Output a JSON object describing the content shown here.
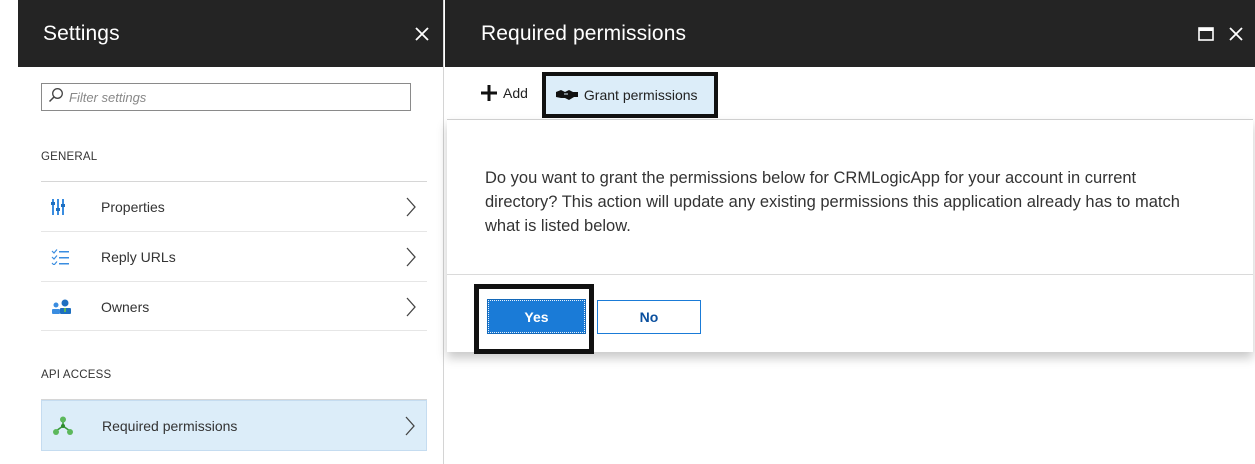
{
  "settings": {
    "title": "Settings",
    "filter_placeholder": "Filter settings",
    "sections": [
      {
        "label": "GENERAL",
        "items": [
          {
            "label": "Properties",
            "icon": "properties-icon"
          },
          {
            "label": "Reply URLs",
            "icon": "reply-urls-icon"
          },
          {
            "label": "Owners",
            "icon": "owners-icon"
          }
        ]
      },
      {
        "label": "API ACCESS",
        "items": [
          {
            "label": "Required permissions",
            "icon": "required-permissions-icon",
            "selected": true
          }
        ]
      }
    ]
  },
  "permissions": {
    "title": "Required permissions",
    "toolbar": {
      "add_label": "Add",
      "grant_label": "Grant permissions"
    },
    "dialog": {
      "message": "Do you want to grant the permissions below for CRMLogicApp for your account in current directory? This action will update any existing permissions this application already has to match what is listed below.",
      "yes_label": "Yes",
      "no_label": "No"
    }
  },
  "colors": {
    "header_bg": "#242424",
    "accent": "#1a7bd7",
    "selected_bg": "#dcedf9"
  }
}
